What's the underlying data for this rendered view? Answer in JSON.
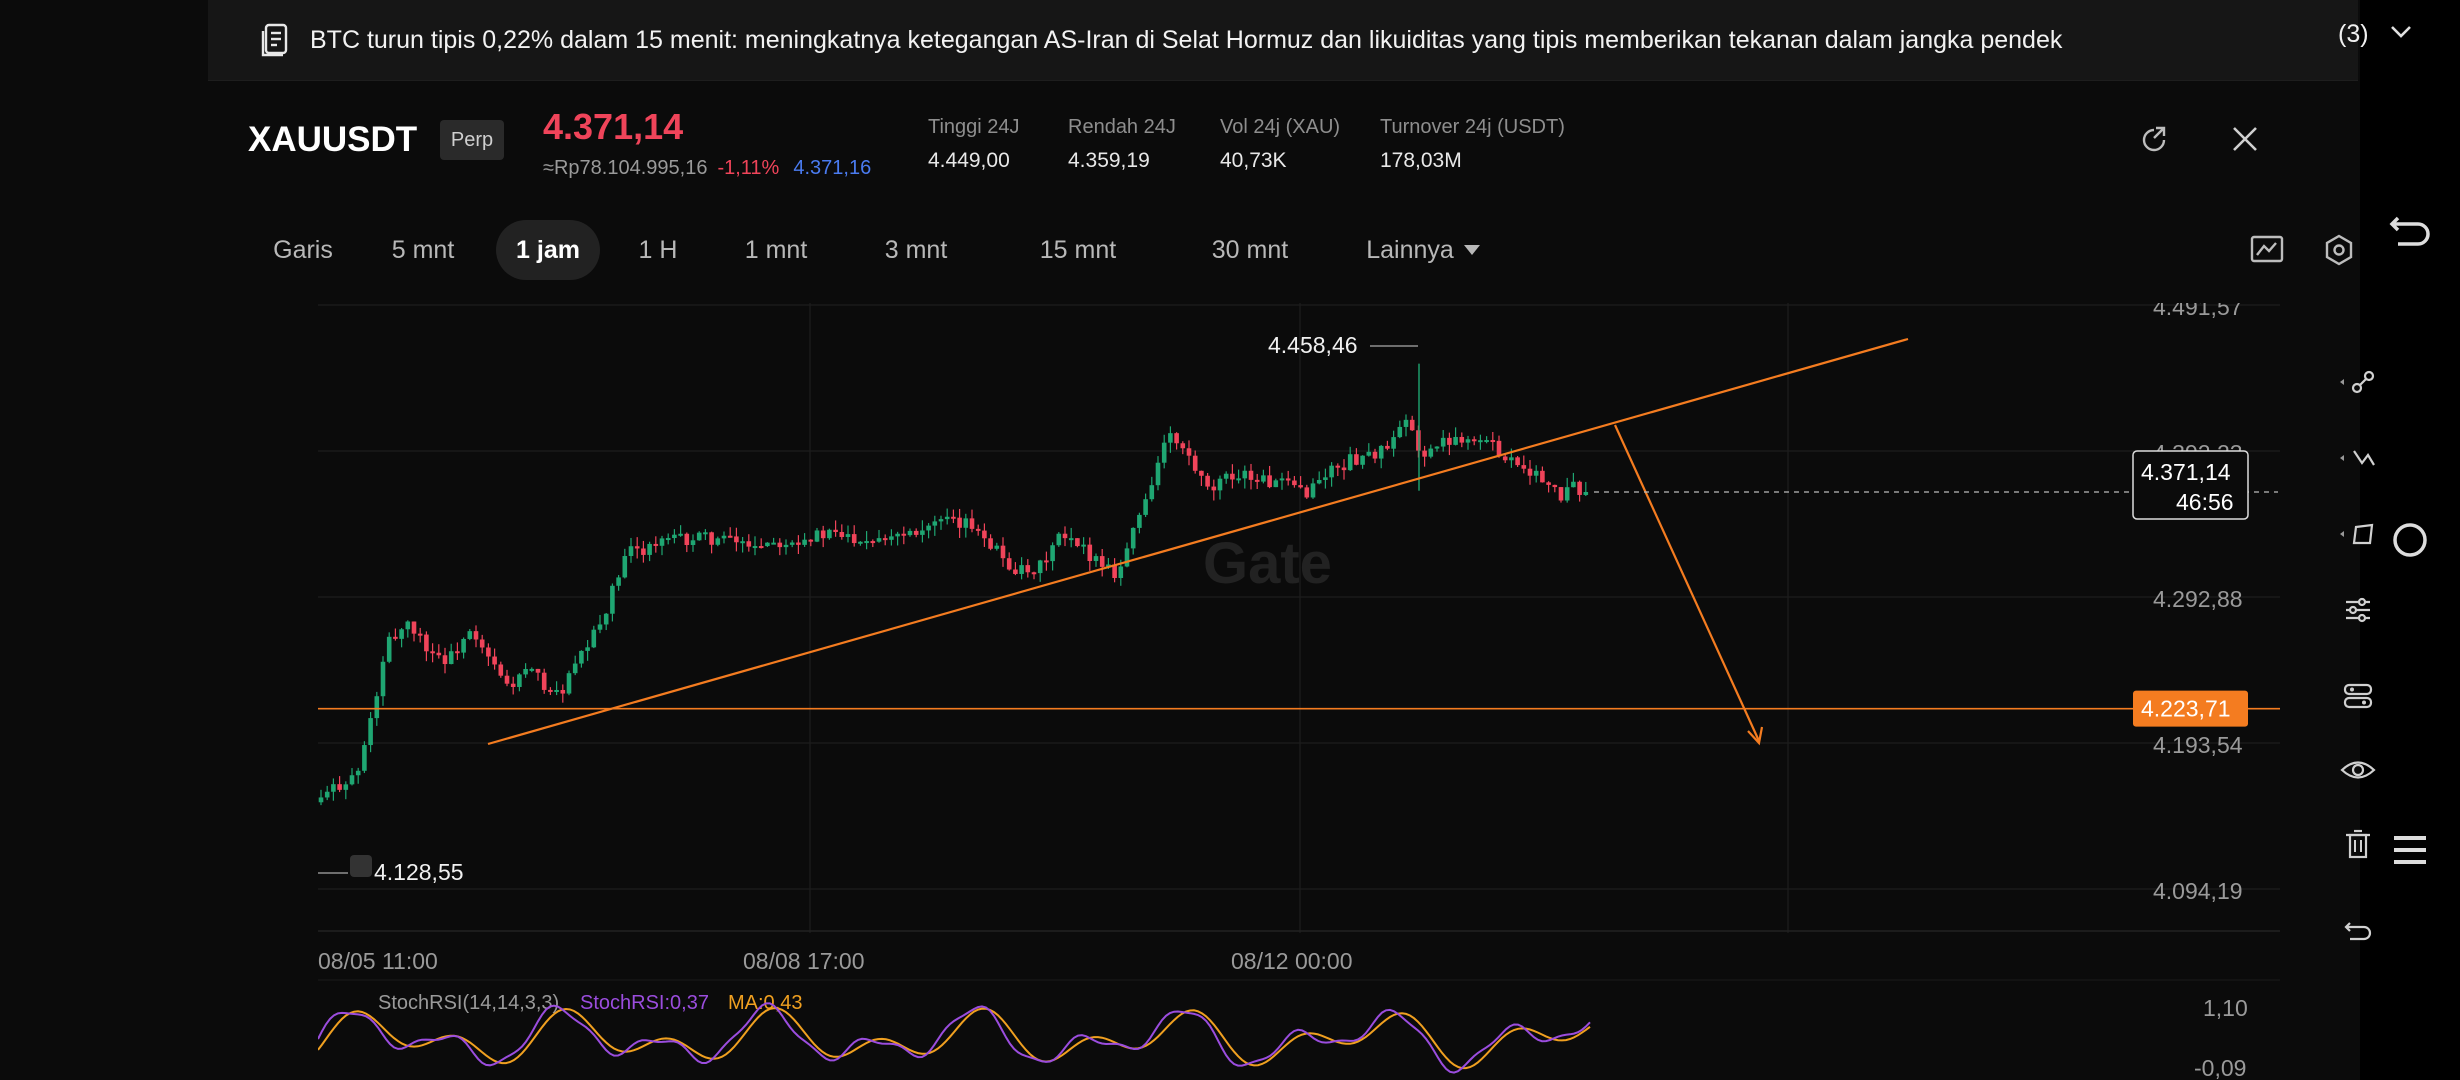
{
  "news": {
    "text": "BTC turun tipis 0,22% dalam 15 menit: meningkatnya ketegangan AS-Iran di Selat Hormuz dan likuiditas yang tipis memberikan tekanan dalam jangka pendek",
    "count": "(3)",
    "icon": "document-icon"
  },
  "ticker": {
    "symbol": "XAUUSDT",
    "badge": "Perp",
    "price": "4.371,14",
    "fiat": "≈Rp78.104.995,16",
    "change": "-1,11%",
    "mark_price": "4.371,16",
    "stats": [
      {
        "label": "Tinggi 24J",
        "value": "4.449,00"
      },
      {
        "label": "Rendah 24J",
        "value": "4.359,19"
      },
      {
        "label": "Vol 24j (XAU)",
        "value": "40,73K"
      },
      {
        "label": "Turnover 24j (USDT)",
        "value": "178,03M"
      }
    ]
  },
  "tabs": [
    "Garis",
    "5 mnt",
    "1 jam",
    "1 H",
    "1 mnt",
    "3 mnt",
    "15 mnt",
    "30 mnt",
    "Lainnya"
  ],
  "active_tab": "1 jam",
  "watermark": "Gate",
  "colors": {
    "up": "#1fa672",
    "down": "#f0445a",
    "accent": "#f47c20",
    "stoch_k": "#9b4dde",
    "stoch_d": "#f0a020"
  },
  "chart_data": {
    "type": "candlestick",
    "price_axis": [
      "4.491,57",
      "4.392,23",
      "4.292,88",
      "4.193,54",
      "4.094,19"
    ],
    "time_axis": [
      "08/05 11:00",
      "08/08 17:00",
      "08/12 00:00"
    ],
    "high_label": "4.458,46",
    "low_label": "4.128,55",
    "current_price": "4.371,14",
    "countdown": "46:56",
    "hline_price": "4.223,71",
    "indicator": {
      "name": "StochRSI(14,14,3,3)",
      "k_label": "StochRSI:0,37",
      "d_label": "MA:0,43",
      "axis": [
        "1,10",
        "-0,09"
      ]
    }
  }
}
